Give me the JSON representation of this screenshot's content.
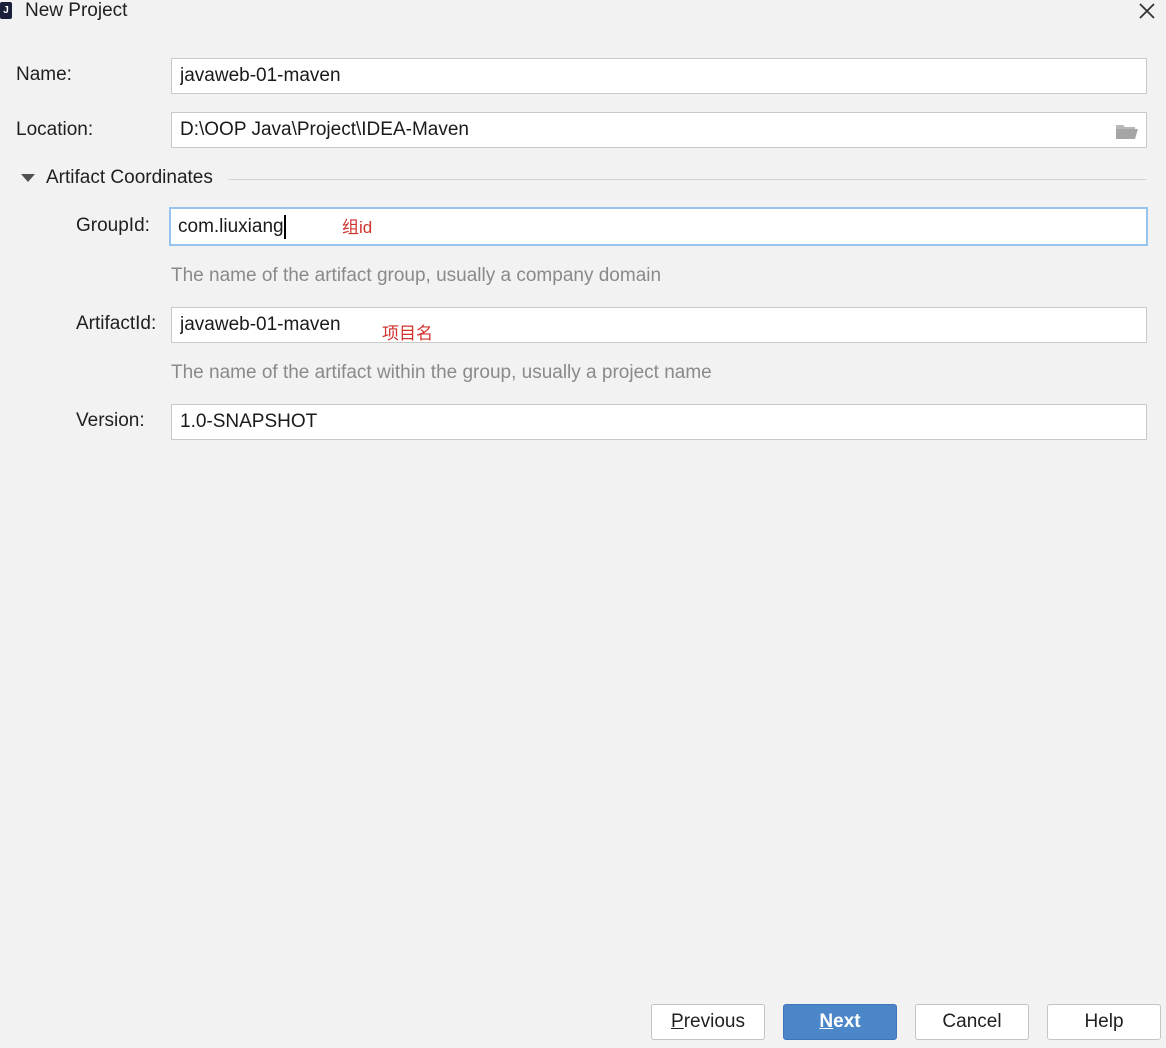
{
  "window": {
    "title": "New Project",
    "app_icon_glyph": "J",
    "close_icon": "close-icon"
  },
  "form": {
    "name": {
      "label": "Name:",
      "value": "javaweb-01-maven"
    },
    "location": {
      "label": "Location:",
      "value": "D:\\OOP Java\\Project\\IDEA-Maven",
      "browse_icon": "folder-icon"
    },
    "artifact_section": {
      "title": "Artifact Coordinates",
      "expanded": true
    },
    "group_id": {
      "label": "GroupId:",
      "value": "com.liuxiang",
      "annotation": "组id",
      "hint": "The name of the artifact group, usually a company domain"
    },
    "artifact_id": {
      "label": "ArtifactId:",
      "value": "javaweb-01-maven",
      "annotation": "项目名",
      "hint": "The name of the artifact within the group, usually a project name"
    },
    "version": {
      "label": "Version:",
      "value": "1.0-SNAPSHOT"
    }
  },
  "buttons": {
    "previous": {
      "mnemonic": "P",
      "rest": "revious"
    },
    "next": {
      "mnemonic": "N",
      "rest": "ext"
    },
    "cancel": "Cancel",
    "help": "Help"
  },
  "colors": {
    "background": "#f2f2f2",
    "accent": "#4a86c8",
    "focus_border": "#97c3ef",
    "annotation": "#d0322d",
    "hint_text": "#8a8a8a"
  }
}
